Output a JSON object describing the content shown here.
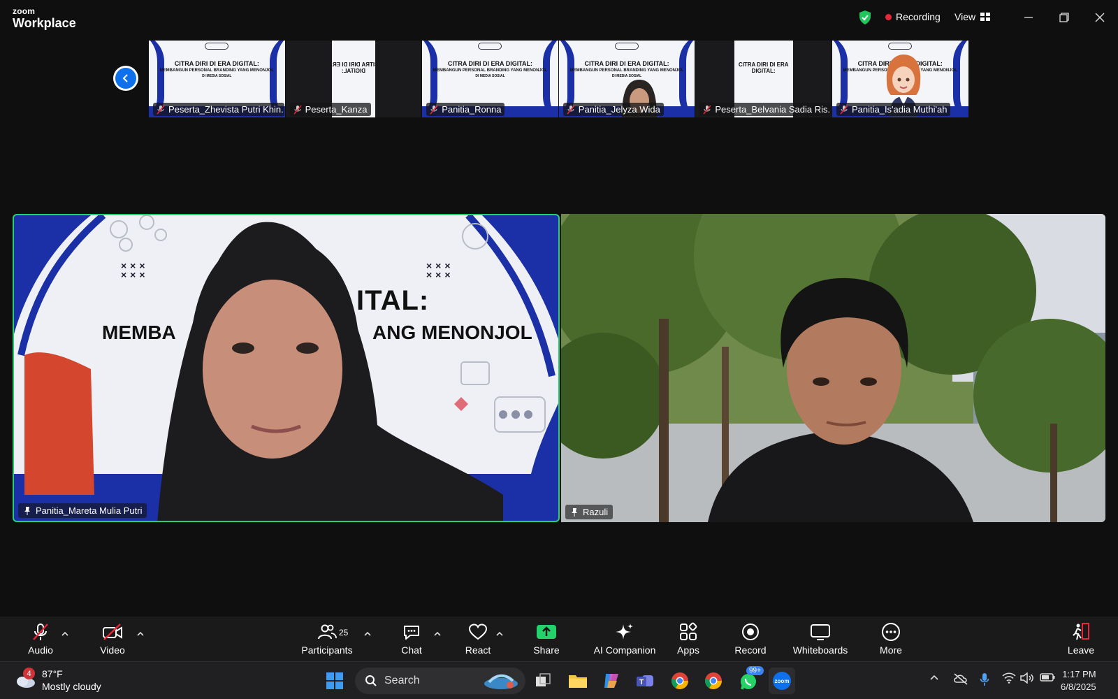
{
  "titlebar": {
    "brand_small": "zoom",
    "brand_big": "Workplace",
    "recording_label": "Recording",
    "view_label": "View"
  },
  "thumbnails": [
    {
      "name": "Peserta_Zhevista Putri Khin...",
      "muted": true
    },
    {
      "name": "Peserta_Kanza",
      "muted": true
    },
    {
      "name": "Panitia_Ronna",
      "muted": true
    },
    {
      "name": "Panitia_Jelyza Wida",
      "muted": true
    },
    {
      "name": "Peserta_Belvania Sadia Ris...",
      "muted": true
    },
    {
      "name": "Panitia_Is'adia Muthi'ah",
      "muted": true
    }
  ],
  "slide_text": {
    "title": "CITRA DIRI DI ERA DIGITAL:",
    "subtitle": "MEMBANGUN PERSONAL BRANDING YANG MENONJOL",
    "subline": "DI MEDIA SOSIAL",
    "big_title_fragment": "ITAL:",
    "big_sub_left": "MEMBA",
    "big_sub_right": "ANG MENONJOL"
  },
  "main_videos": [
    {
      "name": "Panitia_Mareta Mulia Putri",
      "active_speaker": true
    },
    {
      "name": "Razuli",
      "active_speaker": false
    }
  ],
  "toolbar": {
    "audio": "Audio",
    "video": "Video",
    "participants": "Participants",
    "participants_count": "25",
    "chat": "Chat",
    "react": "React",
    "share": "Share",
    "ai_companion": "AI Companion",
    "apps": "Apps",
    "record": "Record",
    "whiteboards": "Whiteboards",
    "more": "More",
    "leave": "Leave"
  },
  "taskbar": {
    "weather_badge": "4",
    "temperature": "87°F",
    "condition": "Mostly cloudy",
    "search_placeholder": "Search",
    "whatsapp_badge": "99+",
    "time": "1:17 PM",
    "date": "6/8/2025"
  },
  "colors": {
    "active_border": "#23d26a",
    "record_dot": "#e8273a",
    "share_green": "#23d26a",
    "zoom_blue": "#0e71eb",
    "slide_blue": "#1b2fa6"
  }
}
